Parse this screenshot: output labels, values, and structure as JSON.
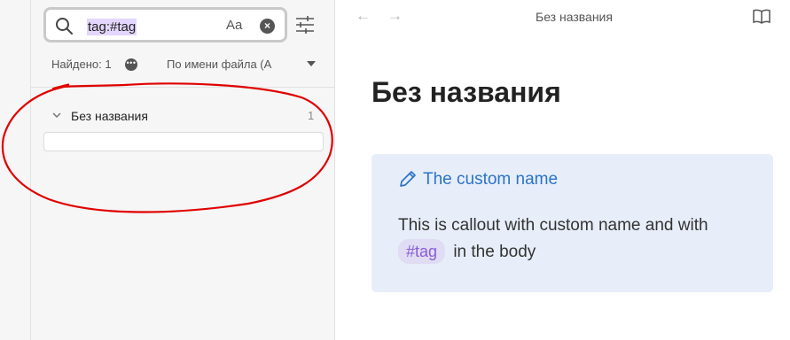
{
  "search": {
    "query": "tag:#tag",
    "case_label": "Aa"
  },
  "results_meta": {
    "found": "Найдено: 1",
    "dots": "•••",
    "sort": "По имени файла (А"
  },
  "results": [
    {
      "title": "Без названия",
      "count": "1"
    }
  ],
  "topbar": {
    "back": "←",
    "forward": "→",
    "title": "Без названия"
  },
  "note": {
    "title": "Без названия",
    "callout": {
      "title": "The custom name",
      "body_before": "This is callout with custom name and with",
      "tag": "#tag",
      "body_after": "in the body"
    }
  },
  "colors": {
    "accent": "#2a73c9",
    "tag": "#8a5cd6",
    "callout_bg": "#e7eef9",
    "annotation": "#e00000"
  },
  "icons": [
    "search-icon",
    "clear-icon",
    "search-settings-icon",
    "more-icon",
    "chevron-down-icon",
    "pencil-icon",
    "reading-mode-icon"
  ]
}
